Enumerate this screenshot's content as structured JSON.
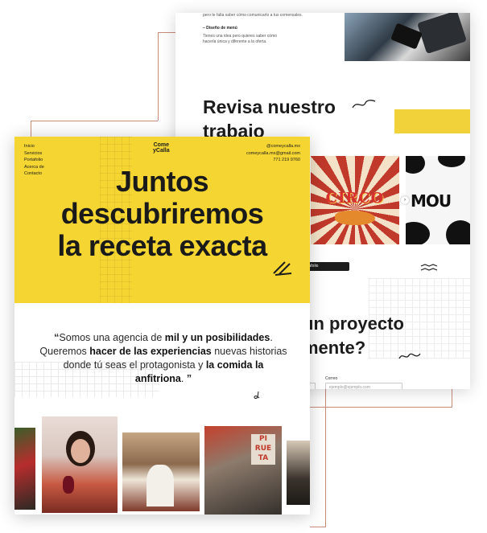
{
  "back_page": {
    "intro_text": "pero te falta saber cómo comunicarlo a tus comensales.",
    "menu_heading": "– Diseño de menú",
    "menu_text_1": "Tienes una idea pero quieres saber cómo",
    "menu_text_2": "hacerla única y diferente a la oferta.",
    "work_title_line1": "Revisa nuestro",
    "work_title_line2": "trabajo",
    "circo_label": "CIRCO",
    "cow_label": "MOU",
    "portfolio_button": "Ver portafolio",
    "project_title_line1": "un proyecto",
    "project_title_line2": "mente?",
    "email_label": "Correo",
    "email_placeholder": "ejemplo@ejemplo.com"
  },
  "front_page": {
    "nav": [
      "Inicio",
      "Servicios",
      "Portafolio",
      "Acerca de",
      "Contacto"
    ],
    "logo_line1": "Come",
    "logo_line2": "yCalla",
    "contact": {
      "handle": "@comeycalla.mx",
      "email": "comeycalla.mx@gmail.com",
      "phone": "771 219 9760"
    },
    "hero_title_line1": "Juntos",
    "hero_title_line2": "descubriremos",
    "hero_title_line3": "la receta exacta",
    "quote": {
      "open_mark": "“",
      "part1": "Somos una agencia de ",
      "bold1": "mil y un posibilidades",
      "part2": ". Queremos ",
      "bold2": "hacer de las experiencias",
      "part3": " nuevas historias donde tú seas el protagonista y ",
      "bold3": "la comida la anfitriona",
      "part4": ".",
      "close_mark": " ”"
    }
  },
  "colors": {
    "brand_yellow": "#f4d531",
    "dark": "#1c1c1c",
    "accent_red": "#c0392b"
  }
}
